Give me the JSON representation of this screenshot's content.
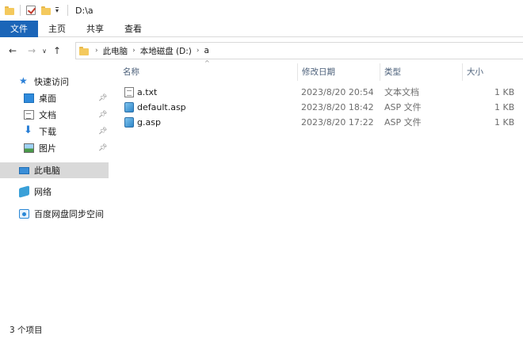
{
  "titlebar": {
    "path": "D:\\a"
  },
  "ribbon": {
    "tabs": [
      "文件",
      "主页",
      "共享",
      "查看"
    ]
  },
  "address": {
    "segments": [
      "此电脑",
      "本地磁盘 (D:)",
      "a"
    ]
  },
  "sidebar": {
    "quick_access": "快速访问",
    "quick_items": [
      "桌面",
      "文档",
      "下载",
      "图片"
    ],
    "this_pc": "此电脑",
    "network": "网络",
    "baidu": "百度网盘同步空间"
  },
  "columns": {
    "name": "名称",
    "modified": "修改日期",
    "type": "类型",
    "size": "大小"
  },
  "files": [
    {
      "name": "a.txt",
      "modified": "2023/8/20 20:54",
      "type": "文本文档",
      "size": "1 KB",
      "icon": "text-file-icon"
    },
    {
      "name": "default.asp",
      "modified": "2023/8/20 18:42",
      "type": "ASP 文件",
      "size": "1 KB",
      "icon": "asp-file-icon"
    },
    {
      "name": "g.asp",
      "modified": "2023/8/20 17:22",
      "type": "ASP 文件",
      "size": "1 KB",
      "icon": "asp-file-icon"
    }
  ],
  "status": {
    "item_count": "3 个项目"
  },
  "colors": {
    "file_tab": "#1b65b8",
    "selected_bg": "#d9d9d9",
    "header_text": "#4c607a"
  }
}
